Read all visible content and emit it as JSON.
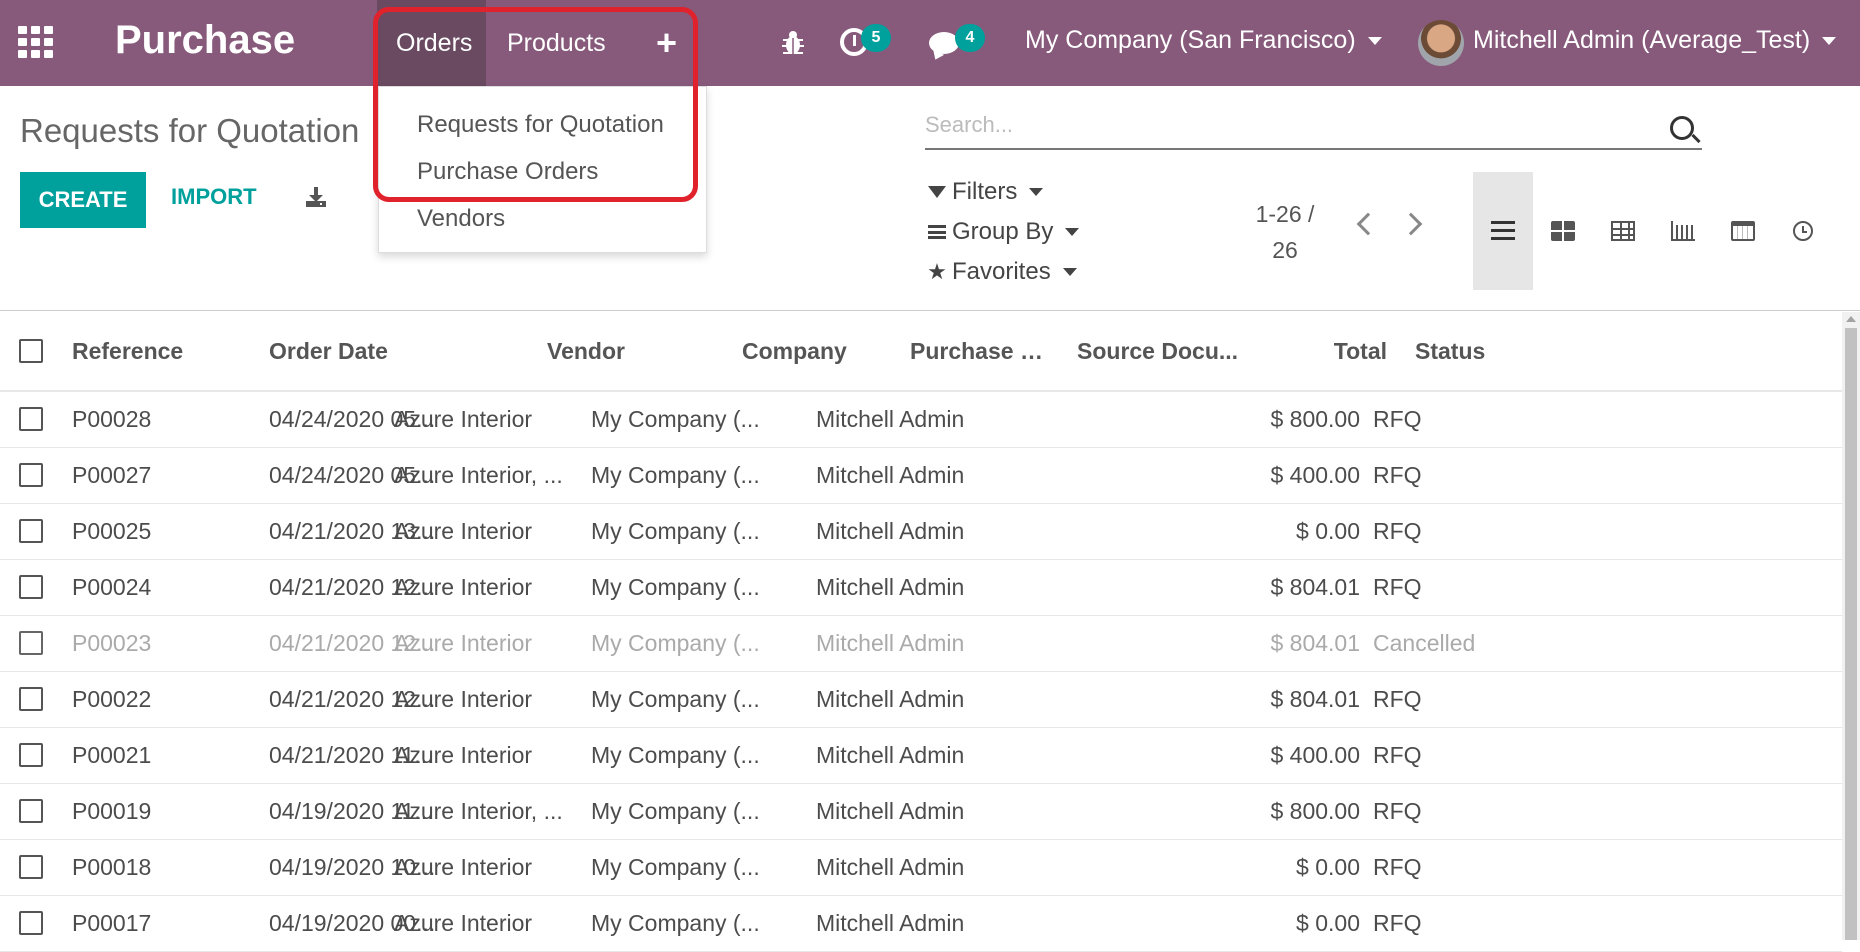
{
  "navbar": {
    "brand": "Purchase",
    "menu": {
      "orders": "Orders",
      "products": "Products",
      "plus": "+"
    },
    "activity_count": "5",
    "messages_count": "4",
    "company": "My Company (San Francisco)",
    "user": "Mitchell Admin (Average_Test)"
  },
  "dropdown": {
    "items": [
      "Requests for Quotation",
      "Purchase Orders",
      "Vendors"
    ]
  },
  "control_panel": {
    "title": "Requests for Quotation",
    "create_label": "CREATE",
    "import_label": "IMPORT",
    "search_placeholder": "Search...",
    "filters_label": "Filters",
    "group_by_label": "Group By",
    "favorites_label": "Favorites",
    "pager_range": "1-26 /",
    "pager_total": "26"
  },
  "table": {
    "columns": [
      "Reference",
      "Order Date",
      "Vendor",
      "Company",
      "Purchase Re...",
      "Source Docu...",
      "Total",
      "Status"
    ],
    "rows": [
      {
        "ref": "P00028",
        "date": "04/24/2020 05...",
        "vendor": "Azure Interior",
        "company": "My Company (...",
        "rep": "Mitchell Admin",
        "source": "",
        "total": "$ 800.00",
        "status": "RFQ",
        "cancelled": false
      },
      {
        "ref": "P00027",
        "date": "04/24/2020 05...",
        "vendor": "Azure Interior, ...",
        "company": "My Company (...",
        "rep": "Mitchell Admin",
        "source": "",
        "total": "$ 400.00",
        "status": "RFQ",
        "cancelled": false
      },
      {
        "ref": "P00025",
        "date": "04/21/2020 13...",
        "vendor": "Azure Interior",
        "company": "My Company (...",
        "rep": "Mitchell Admin",
        "source": "",
        "total": "$ 0.00",
        "status": "RFQ",
        "cancelled": false
      },
      {
        "ref": "P00024",
        "date": "04/21/2020 12...",
        "vendor": "Azure Interior",
        "company": "My Company (...",
        "rep": "Mitchell Admin",
        "source": "",
        "total": "$ 804.01",
        "status": "RFQ",
        "cancelled": false
      },
      {
        "ref": "P00023",
        "date": "04/21/2020 12...",
        "vendor": "Azure Interior",
        "company": "My Company (...",
        "rep": "Mitchell Admin",
        "source": "",
        "total": "$ 804.01",
        "status": "Cancelled",
        "cancelled": true
      },
      {
        "ref": "P00022",
        "date": "04/21/2020 12...",
        "vendor": "Azure Interior",
        "company": "My Company (...",
        "rep": "Mitchell Admin",
        "source": "",
        "total": "$ 804.01",
        "status": "RFQ",
        "cancelled": false
      },
      {
        "ref": "P00021",
        "date": "04/21/2020 11...",
        "vendor": "Azure Interior",
        "company": "My Company (...",
        "rep": "Mitchell Admin",
        "source": "",
        "total": "$ 400.00",
        "status": "RFQ",
        "cancelled": false
      },
      {
        "ref": "P00019",
        "date": "04/19/2020 11...",
        "vendor": "Azure Interior, ...",
        "company": "My Company (...",
        "rep": "Mitchell Admin",
        "source": "",
        "total": "$ 800.00",
        "status": "RFQ",
        "cancelled": false
      },
      {
        "ref": "P00018",
        "date": "04/19/2020 10...",
        "vendor": "Azure Interior",
        "company": "My Company (...",
        "rep": "Mitchell Admin",
        "source": "",
        "total": "$ 0.00",
        "status": "RFQ",
        "cancelled": false
      },
      {
        "ref": "P00017",
        "date": "04/19/2020 00...",
        "vendor": "Azure Interior",
        "company": "My Company (...",
        "rep": "Mitchell Admin",
        "source": "",
        "total": "$ 0.00",
        "status": "RFQ",
        "cancelled": false
      }
    ]
  },
  "colors": {
    "navbar": "#875a7b",
    "navbar_active": "#694a60",
    "accent": "#00a09d",
    "highlight": "#e0222d"
  }
}
